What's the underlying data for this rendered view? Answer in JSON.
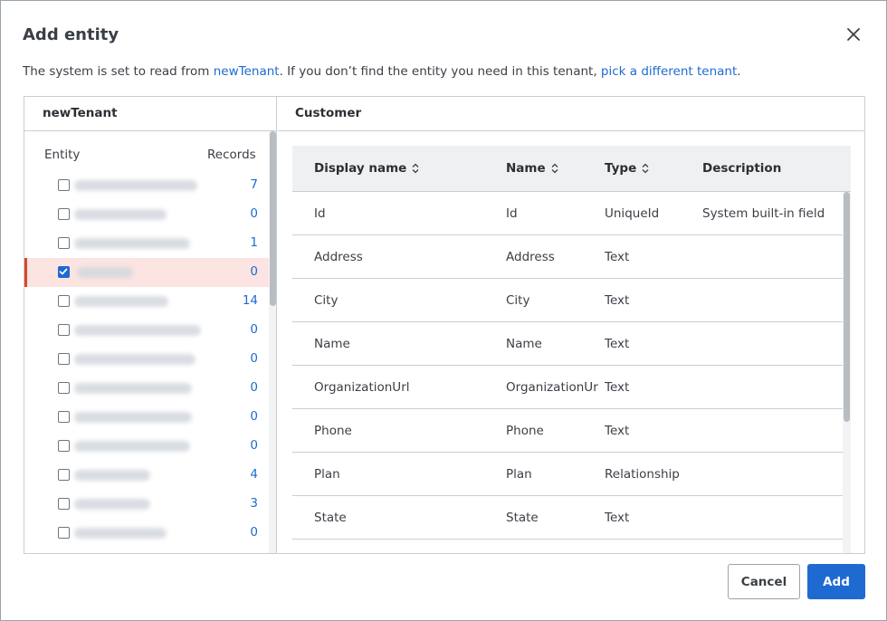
{
  "dialog": {
    "title": "Add entity",
    "subtitle_prefix": "The system is set to read from ",
    "subtitle_tenant": "newTenant",
    "subtitle_middle": ". If you don’t find the entity you need in this tenant, ",
    "subtitle_link": "pick a different tenant",
    "subtitle_suffix": "."
  },
  "left_panel": {
    "tenant": "newTenant",
    "entity_header": "Entity",
    "records_header": "Records",
    "entities": [
      {
        "records": "7",
        "checked": false
      },
      {
        "records": "0",
        "checked": false
      },
      {
        "records": "1",
        "checked": false
      },
      {
        "records": "0",
        "checked": true
      },
      {
        "records": "14",
        "checked": false
      },
      {
        "records": "0",
        "checked": false
      },
      {
        "records": "0",
        "checked": false
      },
      {
        "records": "0",
        "checked": false
      },
      {
        "records": "0",
        "checked": false
      },
      {
        "records": "0",
        "checked": false
      },
      {
        "records": "4",
        "checked": false
      },
      {
        "records": "3",
        "checked": false
      },
      {
        "records": "0",
        "checked": false
      }
    ]
  },
  "right_panel": {
    "entity": "Customer",
    "columns": {
      "display_name": "Display name",
      "name": "Name",
      "type": "Type",
      "description": "Description"
    },
    "rows": [
      {
        "display_name": "Id",
        "name": "Id",
        "type": "UniqueId",
        "description": "System built-in field"
      },
      {
        "display_name": "Address",
        "name": "Address",
        "type": "Text",
        "description": ""
      },
      {
        "display_name": "City",
        "name": "City",
        "type": "Text",
        "description": ""
      },
      {
        "display_name": "Name",
        "name": "Name",
        "type": "Text",
        "description": ""
      },
      {
        "display_name": "OrganizationUrl",
        "name": "OrganizationUrl",
        "type": "Text",
        "description": ""
      },
      {
        "display_name": "Phone",
        "name": "Phone",
        "type": "Text",
        "description": ""
      },
      {
        "display_name": "Plan",
        "name": "Plan",
        "type": "Relationship",
        "description": ""
      },
      {
        "display_name": "State",
        "name": "State",
        "type": "Text",
        "description": ""
      }
    ]
  },
  "footer": {
    "cancel_label": "Cancel",
    "add_label": "Add"
  },
  "colors": {
    "accent": "#1f6ad1",
    "selected_row": "#fbe4e1",
    "selected_marker": "#d9472b"
  }
}
